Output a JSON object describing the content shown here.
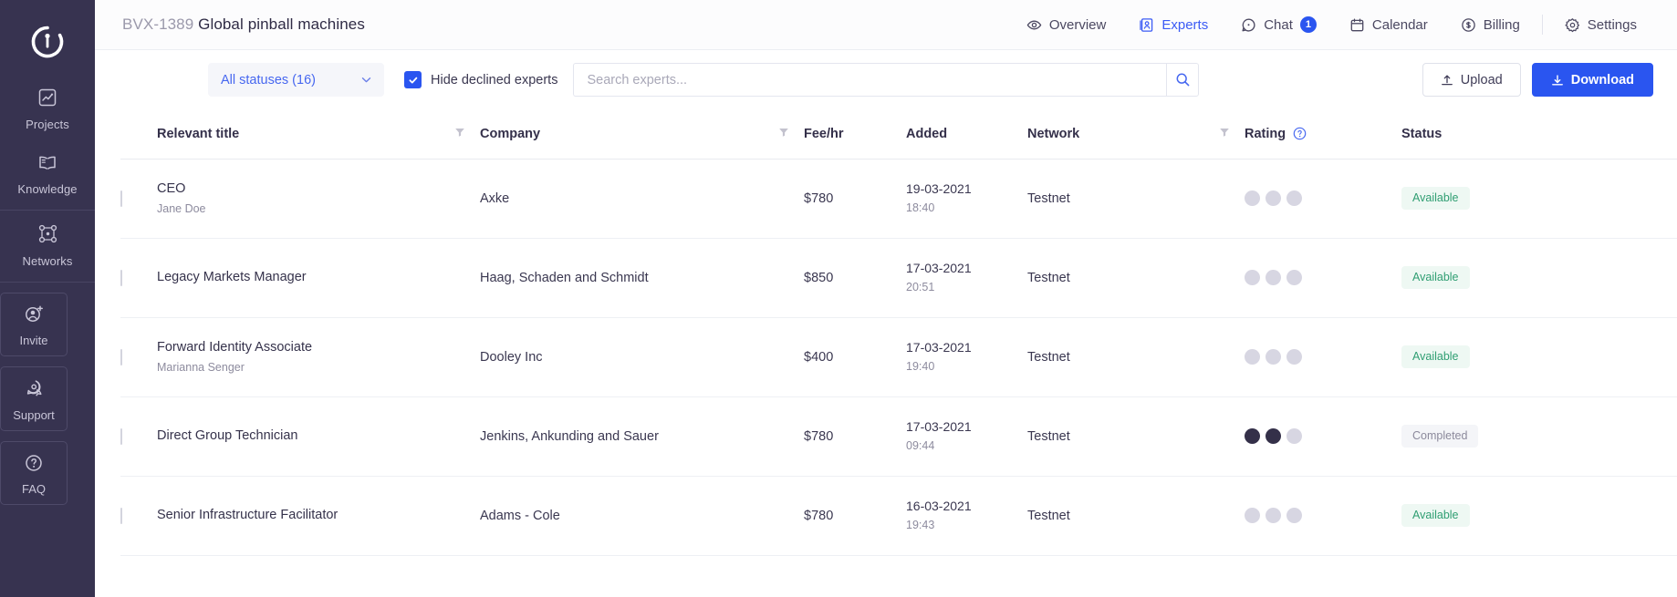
{
  "sidebar": {
    "logo_icon": "clarity-logo-icon",
    "items": [
      {
        "label": "Projects",
        "icon": "chart-frame-icon",
        "boxed": false,
        "sep_after": false
      },
      {
        "label": "Knowledge",
        "icon": "open-book-icon",
        "boxed": false,
        "sep_after": true
      },
      {
        "label": "Networks",
        "icon": "network-nodes-icon",
        "boxed": false,
        "sep_after": true
      },
      {
        "label": "Invite",
        "icon": "user-plus-icon",
        "boxed": true,
        "sep_after": false
      },
      {
        "label": "Support",
        "icon": "chat-support-icon",
        "boxed": true,
        "sep_after": false
      },
      {
        "label": "FAQ",
        "icon": "question-circle-icon",
        "boxed": true,
        "sep_after": false
      }
    ]
  },
  "header": {
    "project_code": "BVX-1389",
    "project_name": "Global pinball machines",
    "nav": [
      {
        "label": "Overview",
        "icon": "eye-icon",
        "active": false,
        "badge": ""
      },
      {
        "label": "Experts",
        "icon": "experts-icon",
        "active": true,
        "badge": ""
      },
      {
        "label": "Chat",
        "icon": "chat-icon",
        "active": false,
        "badge": "1"
      },
      {
        "label": "Calendar",
        "icon": "calendar-icon",
        "active": false,
        "badge": ""
      },
      {
        "label": "Billing",
        "icon": "billing-icon",
        "active": false,
        "badge": ""
      },
      {
        "label": "Settings",
        "icon": "gear-icon",
        "active": false,
        "badge": ""
      }
    ]
  },
  "toolbar": {
    "status_filter_label": "All statuses (16)",
    "status_filter_icon": "chevron-down-icon",
    "hide_declined_label": "Hide declined experts",
    "hide_declined_checked": true,
    "search_placeholder": "Search experts...",
    "search_value": "",
    "search_icon": "search-icon",
    "upload_label": "Upload",
    "upload_icon": "upload-icon",
    "download_label": "Download",
    "download_icon": "download-icon"
  },
  "table": {
    "columns": [
      {
        "label": "Relevant title",
        "filter": true,
        "help": false
      },
      {
        "label": "Company",
        "filter": true,
        "help": false
      },
      {
        "label": "Fee/hr",
        "filter": false,
        "help": false
      },
      {
        "label": "Added",
        "filter": false,
        "help": false
      },
      {
        "label": "Network",
        "filter": true,
        "help": false
      },
      {
        "label": "Rating",
        "filter": false,
        "help": true
      },
      {
        "label": "Status",
        "filter": false,
        "help": false
      }
    ],
    "rows": [
      {
        "title": "CEO",
        "person": "Jane Doe",
        "company": "Axke",
        "fee": "$780",
        "date": "19-03-2021",
        "time": "18:40",
        "network": "Testnet",
        "rating": 0,
        "rating_max": 3,
        "status": "Available",
        "status_kind": "available",
        "selected": false
      },
      {
        "title": "Legacy Markets Manager",
        "person": "",
        "company": "Haag, Schaden and Schmidt",
        "fee": "$850",
        "date": "17-03-2021",
        "time": "20:51",
        "network": "Testnet",
        "rating": 0,
        "rating_max": 3,
        "status": "Available",
        "status_kind": "available",
        "selected": false
      },
      {
        "title": "Forward Identity Associate",
        "person": "Marianna Senger",
        "company": "Dooley Inc",
        "fee": "$400",
        "date": "17-03-2021",
        "time": "19:40",
        "network": "Testnet",
        "rating": 0,
        "rating_max": 3,
        "status": "Available",
        "status_kind": "available",
        "selected": false
      },
      {
        "title": "Direct Group Technician",
        "person": "",
        "company": "Jenkins, Ankunding and Sauer",
        "fee": "$780",
        "date": "17-03-2021",
        "time": "09:44",
        "network": "Testnet",
        "rating": 2,
        "rating_max": 3,
        "status": "Completed",
        "status_kind": "completed",
        "selected": false
      },
      {
        "title": "Senior Infrastructure Facilitator",
        "person": "",
        "company": "Adams - Cole",
        "fee": "$780",
        "date": "16-03-2021",
        "time": "19:43",
        "network": "Testnet",
        "rating": 0,
        "rating_max": 3,
        "status": "Available",
        "status_kind": "available",
        "selected": false
      }
    ]
  },
  "colors": {
    "sidebar_bg": "#373350",
    "accent_blue": "#2a55f0",
    "link_blue": "#4667f0",
    "status_available_fg": "#2f9e72",
    "status_available_bg": "#eef8f3",
    "status_completed_fg": "#8c8a9c",
    "status_completed_bg": "#f4f5f8",
    "rating_filled": "#343049",
    "rating_empty": "#d7d6e2"
  }
}
